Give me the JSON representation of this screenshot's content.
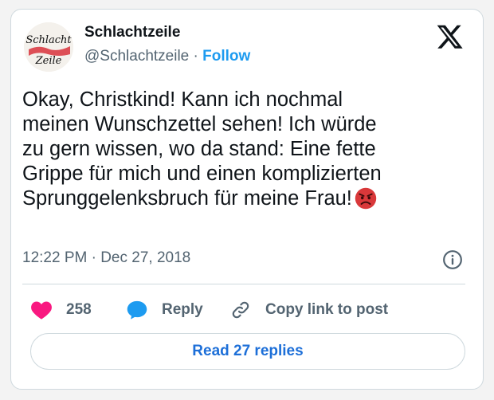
{
  "tweet": {
    "author": {
      "display_name": "Schlachtzeile",
      "handle": "@Schlachtzeile",
      "follow_label": "Follow",
      "avatar_text_top": "Schlacht",
      "avatar_text_bottom": "Zeile"
    },
    "separator": "·",
    "text_lines": [
      "Okay, Christkind! Kann ich nochmal",
      "meinen Wunschzettel sehen! Ich würde",
      "zu gern wissen, wo da stand: Eine fette",
      "Grippe für mich und einen komplizierten",
      "Sprunggelenksbruch für meine Frau!"
    ],
    "emoji": "angry-face-emoji",
    "timestamp": "12:22 PM · Dec 27, 2018",
    "actions": {
      "like_count": "258",
      "reply_label": "Reply",
      "copy_label": "Copy link to post"
    },
    "read_replies_label": "Read 27 replies"
  },
  "icons": {
    "platform": "x-logo-icon",
    "info": "info-icon",
    "like": "heart-icon",
    "reply": "speech-bubble-icon",
    "copy": "link-icon"
  },
  "colors": {
    "link_blue": "#1d9bf0",
    "replies_blue": "#1d6fd8",
    "heart_pink": "#f91880",
    "reply_blue": "#1d9bf0",
    "secondary_text": "#536471",
    "border": "#cfd9de",
    "emoji_red": "#d9383a"
  }
}
